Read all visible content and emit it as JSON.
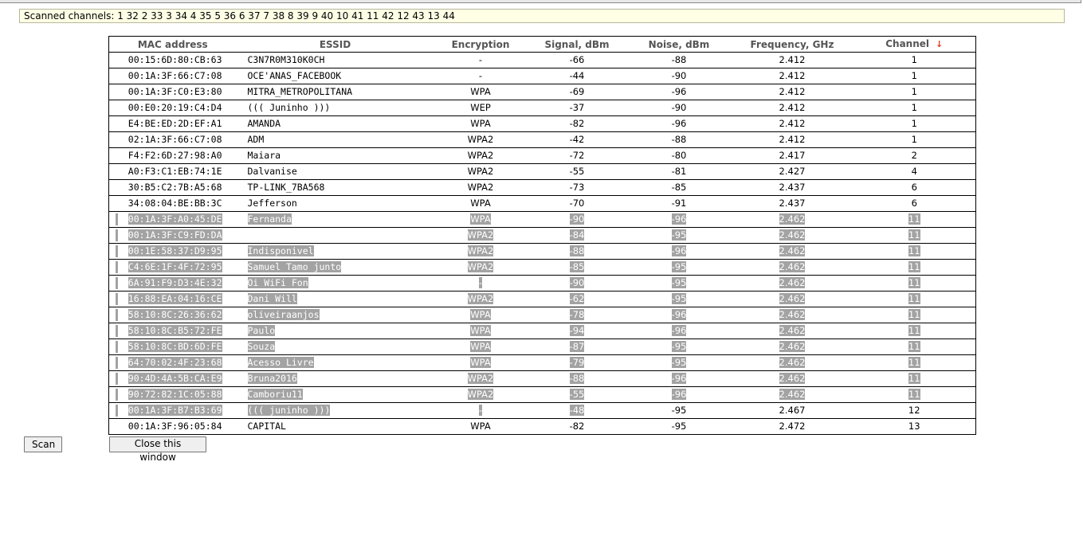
{
  "scanned_channels": "Scanned channels: 1 32 2 33 3 34 4 35 5 36 6 37 7 38 8 39 9 40 10 41 11 42 12 43 13 44",
  "headers": {
    "mac": "MAC address",
    "essid": "ESSID",
    "encryption": "Encryption",
    "signal": "Signal, dBm",
    "noise": "Noise, dBm",
    "frequency": "Frequency, GHz",
    "channel": "Channel",
    "sort_arrow": "↓"
  },
  "rows": [
    {
      "mac": "00:15:6D:80:CB:63",
      "essid": "C3N7R0M310K0CH",
      "enc": "-",
      "signal": "-66",
      "noise": "-88",
      "freq": "2.412",
      "ch": "1",
      "selected": false
    },
    {
      "mac": "00:1A:3F:66:C7:08",
      "essid": "OCE'ANAS_FACEBOOK",
      "enc": "-",
      "signal": "-44",
      "noise": "-90",
      "freq": "2.412",
      "ch": "1",
      "selected": false
    },
    {
      "mac": "00:1A:3F:C0:E3:80",
      "essid": "MITRA_METROPOLITANA",
      "enc": "WPA",
      "signal": "-69",
      "noise": "-96",
      "freq": "2.412",
      "ch": "1",
      "selected": false
    },
    {
      "mac": "00:E0:20:19:C4:D4",
      "essid": "((( Juninho )))",
      "enc": "WEP",
      "signal": "-37",
      "noise": "-90",
      "freq": "2.412",
      "ch": "1",
      "selected": false
    },
    {
      "mac": "E4:BE:ED:2D:EF:A1",
      "essid": "AMANDA",
      "enc": "WPA",
      "signal": "-82",
      "noise": "-96",
      "freq": "2.412",
      "ch": "1",
      "selected": false
    },
    {
      "mac": "02:1A:3F:66:C7:08",
      "essid": "ADM",
      "enc": "WPA2",
      "signal": "-42",
      "noise": "-88",
      "freq": "2.412",
      "ch": "1",
      "selected": false
    },
    {
      "mac": "F4:F2:6D:27:98:A0",
      "essid": "Maiara",
      "enc": "WPA2",
      "signal": "-72",
      "noise": "-80",
      "freq": "2.417",
      "ch": "2",
      "selected": false
    },
    {
      "mac": "A0:F3:C1:EB:74:1E",
      "essid": "Dalvanise",
      "enc": "WPA2",
      "signal": "-55",
      "noise": "-81",
      "freq": "2.427",
      "ch": "4",
      "selected": false
    },
    {
      "mac": "30:B5:C2:7B:A5:68",
      "essid": "TP-LINK_7BA568",
      "enc": "WPA2",
      "signal": "-73",
      "noise": "-85",
      "freq": "2.437",
      "ch": "6",
      "selected": false
    },
    {
      "mac": "34:08:04:BE:BB:3C",
      "essid": "Jefferson",
      "enc": "WPA",
      "signal": "-70",
      "noise": "-91",
      "freq": "2.437",
      "ch": "6",
      "selected": false
    },
    {
      "mac": "00:1A:3F:A0:45:DE",
      "essid": "Fernanda",
      "enc": "WPA",
      "signal": "-90",
      "noise": "-96",
      "freq": "2.462",
      "ch": "11",
      "selected": true
    },
    {
      "mac": "00:1A:3F:C9:FD:DA",
      "essid": "",
      "enc": "WPA2",
      "signal": "-84",
      "noise": "-95",
      "freq": "2.462",
      "ch": "11",
      "selected": true
    },
    {
      "mac": "00:1E:58:37:D9:95",
      "essid": "Indisponivel",
      "enc": "WPA2",
      "signal": "-88",
      "noise": "-96",
      "freq": "2.462",
      "ch": "11",
      "selected": true
    },
    {
      "mac": "C4:6E:1F:4F:72:95",
      "essid": "Samuel Tamo junto",
      "enc": "WPA2",
      "signal": "-85",
      "noise": "-95",
      "freq": "2.462",
      "ch": "11",
      "selected": true
    },
    {
      "mac": "6A:91:F9:D3:4E:32",
      "essid": "Oi WiFi Fon",
      "enc": "-",
      "signal": "-90",
      "noise": "-95",
      "freq": "2.462",
      "ch": "11",
      "selected": true
    },
    {
      "mac": "16:88:EA:04:16:CE",
      "essid": "Dani Will",
      "enc": "WPA2",
      "signal": "-62",
      "noise": "-95",
      "freq": "2.462",
      "ch": "11",
      "selected": true
    },
    {
      "mac": "58:10:8C:26:36:62",
      "essid": "oliveiraanjos",
      "enc": "WPA",
      "signal": "-78",
      "noise": "-96",
      "freq": "2.462",
      "ch": "11",
      "selected": true
    },
    {
      "mac": "58:10:8C:B5:72:FE",
      "essid": "Paulo",
      "enc": "WPA",
      "signal": "-94",
      "noise": "-96",
      "freq": "2.462",
      "ch": "11",
      "selected": true
    },
    {
      "mac": "58:10:8C:BD:6D:FE",
      "essid": "Souza",
      "enc": "WPA",
      "signal": "-87",
      "noise": "-95",
      "freq": "2.462",
      "ch": "11",
      "selected": true
    },
    {
      "mac": "64:70:02:4F:23:68",
      "essid": "Acesso Livre",
      "enc": "WPA",
      "signal": "-79",
      "noise": "-95",
      "freq": "2.462",
      "ch": "11",
      "selected": true
    },
    {
      "mac": "90:4D:4A:5B:CA:E9",
      "essid": "Bruna2016",
      "enc": "WPA2",
      "signal": "-88",
      "noise": "-96",
      "freq": "2.462",
      "ch": "11",
      "selected": true
    },
    {
      "mac": "90:72:82:1C:05:88",
      "essid": "Camboriu11",
      "enc": "WPA2",
      "signal": "-55",
      "noise": "-96",
      "freq": "2.462",
      "ch": "11",
      "selected": true
    },
    {
      "mac": "00:1A:3F:B7:B3:69",
      "essid": "((( juninho )))",
      "enc": "-",
      "signal": "-48",
      "noise": "-95",
      "freq": "2.467",
      "ch": "12",
      "selected": "partial"
    },
    {
      "mac": "00:1A:3F:96:05:84",
      "essid": "CAPITAL",
      "enc": "WPA",
      "signal": "-82",
      "noise": "-95",
      "freq": "2.472",
      "ch": "13",
      "selected": false
    }
  ],
  "buttons": {
    "scan": "Scan",
    "close": "Close this window"
  }
}
